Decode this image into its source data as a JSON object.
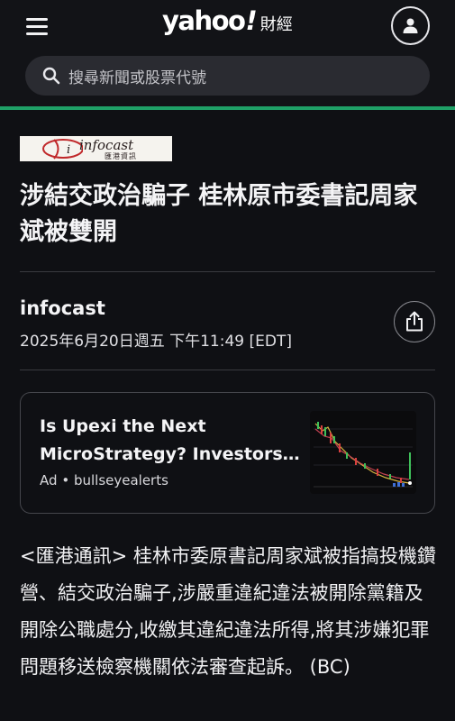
{
  "header": {
    "brand": "yahoo",
    "brand_mark": "!",
    "brand_suffix": "財經",
    "menu_icon": "hamburger-icon",
    "profile_icon": "user-icon"
  },
  "search": {
    "placeholder": "搜尋新聞或股票代號",
    "icon": "search-icon"
  },
  "colors": {
    "background": "#0f1014",
    "accent_bar": "#1fa167"
  },
  "article": {
    "source_logo_text": "infocast",
    "source_logo_subtext": "匯港資訊",
    "title": "涉結交政治騙子 桂林原市委書記周家斌被雙開",
    "author": "infocast",
    "date": "2025年6月20日週五 下午11:49 [EDT]",
    "share_icon": "share-icon",
    "body": "<匯港通訊> 桂林市委原書記周家斌被指搞投機鑽營、結交政治騙子,涉嚴重違紀違法被開除黨籍及開除公職處分,收繳其違紀違法所得,將其涉嫌犯罪問題移送檢察機關依法審查起訴。 (BC)"
  },
  "ad": {
    "title": "Is Upexi the Next MicroStrategy? Investors…",
    "label": "Ad",
    "separator": "•",
    "advertiser": "bullseyealerts"
  }
}
